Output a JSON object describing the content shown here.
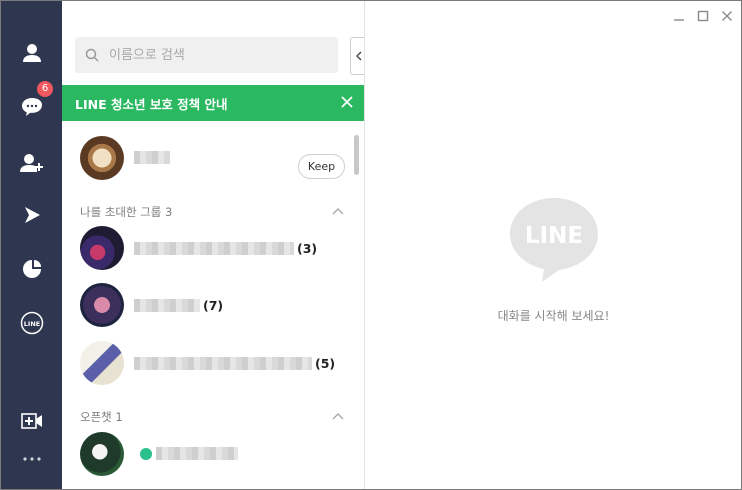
{
  "sidebar": {
    "items": [
      {
        "icon": "friends-icon"
      },
      {
        "icon": "chats-icon",
        "badge": "6"
      },
      {
        "icon": "add-friend-icon"
      },
      {
        "icon": "timeline-icon"
      },
      {
        "icon": "today-icon"
      },
      {
        "icon": "line-services-icon",
        "label": "LINE"
      },
      {
        "icon": "video-call-icon"
      },
      {
        "icon": "more-icon"
      }
    ]
  },
  "search": {
    "placeholder": "이름으로 검색"
  },
  "banner": {
    "text": "LINE 청소년 보호 정책 안내"
  },
  "profile": {
    "keep_label": "Keep"
  },
  "groups": {
    "title": "나를 초대한 그룹 3",
    "items": [
      {
        "count": "(3)"
      },
      {
        "count": "(7)"
      },
      {
        "count": "(5)"
      }
    ]
  },
  "openchat": {
    "title": "오픈챗  1"
  },
  "right": {
    "logo_text": "LINE",
    "empty_message": "대화를 시작해 보세요!"
  },
  "colors": {
    "sidebar": "#2e3650",
    "accent": "#2ab861",
    "badge": "#f0585f"
  }
}
